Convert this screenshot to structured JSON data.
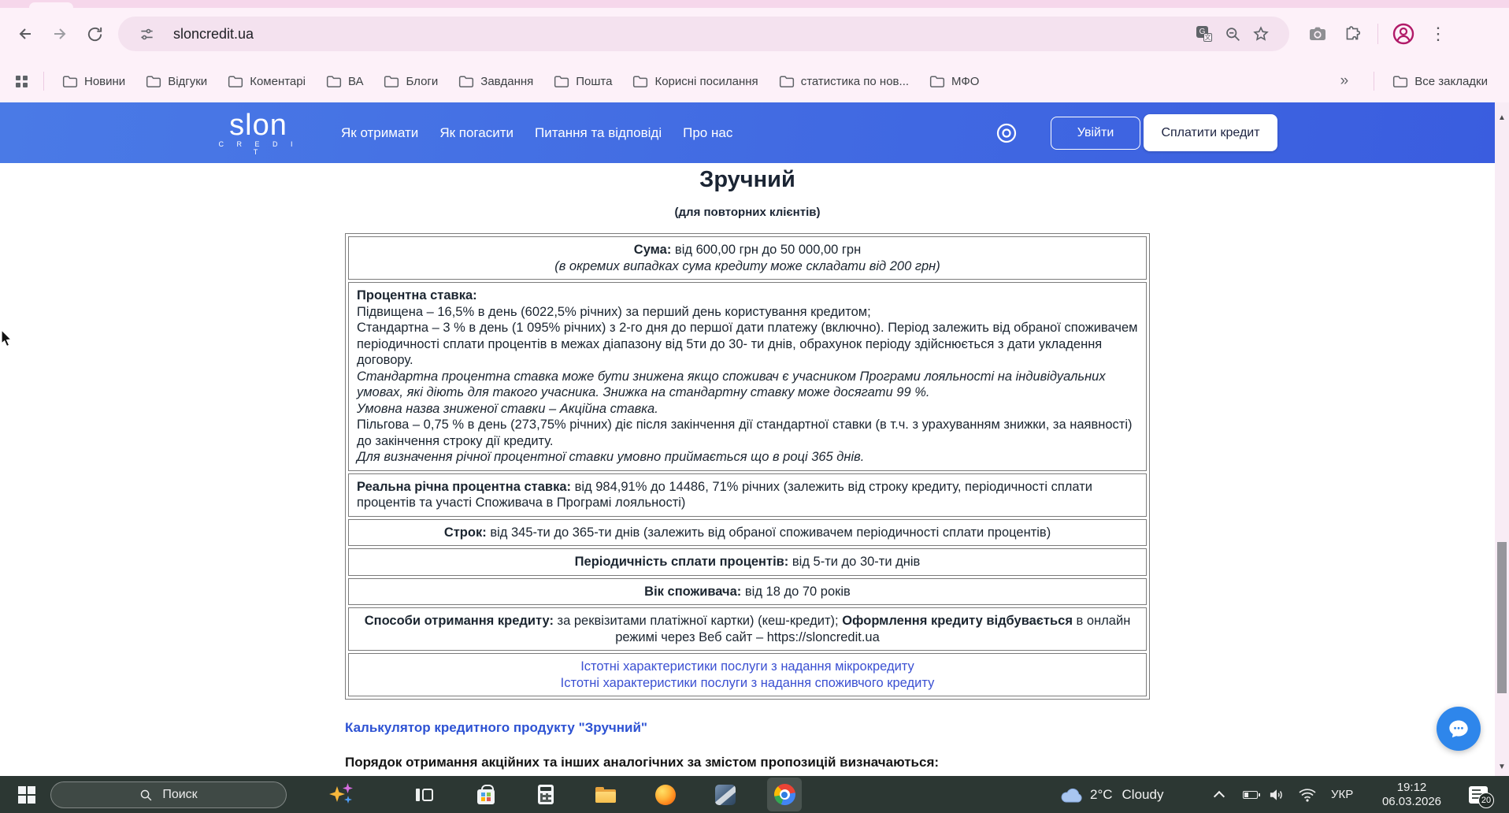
{
  "browser": {
    "url": "sloncredit.ua",
    "bookmarks": [
      "Новини",
      "Відгуки",
      "Коментарі",
      "ВА",
      "Блоги",
      "Завдання",
      "Пошта",
      "Корисні посилання",
      "статистика по нов...",
      "МФО"
    ],
    "overflow_chevron": "»",
    "all_bookmarks_label": "Все закладки",
    "menu_glyph": "⋮"
  },
  "site": {
    "logo_text": "slon",
    "logo_sub": "C R E D I T",
    "nav": [
      "Як отримати",
      "Як погасити",
      "Питання та відповіді",
      "Про нас"
    ],
    "login_button": "Увійти",
    "pay_button": "Сплатити кредит"
  },
  "page": {
    "title": "Зручний",
    "subtitle": "(для повторних клієнтів)",
    "table": {
      "sum_label": "Сума:",
      "sum_value": " від 600,00 грн до 50 000,00 грн",
      "sum_note": "(в окремих випадках сума кредиту може складати від 200 грн)",
      "rate_heading": "Процентна ставка:",
      "rate_line1": "Підвищена  – 16,5% в день  (6022,5% річних) за перший день користування кредитом;",
      "rate_line2": "Стандартна – 3 % в день (1 095% річних)  з 2-го дня до першої дати платежу (включно). Період залежить  від обраної споживачем періодичності сплати процентів в межах діапазону від 5ти до 30- ти днів, обрахунок періоду здійснюється   з дати укладення договору.",
      "rate_line3": "Стандартна процентна ставка може бути знижена якщо споживач є учасником Програми лояльності на індивідуальних  умовах, які діють для такого учасника. Знижка на стандартну ставку може досягати 99 %.",
      "rate_line4": "Умовна назва зниженої ставки – Акційна ставка.",
      "rate_line5": "Пільгова – 0,75 % в день (273,75% річних)  діє після закінчення дії стандартної ставки (в т.ч. з урахуванням знижки, за наявності)  до закінчення строку дії кредиту.",
      "rate_line6": "Для визначення річної процентної ставки умовно приймається що в році 365 днів.",
      "apr_label": "Реальна річна процентна ставка:",
      "apr_value": " від 984,91% до 14486, 71% річних (залежить від строку кредиту, періодичності сплати процентів та участі Споживача в Програмі лояльності)",
      "term_label": "Строк:",
      "term_value": " від 345-ти до 365-ти днів (залежить від обраної споживачем періодичності сплати процентів)",
      "periodicity_label": "Періодичність сплати процентів:",
      "periodicity_value": " від 5-ти до 30-ти днів",
      "age_label": "Вік споживача:",
      "age_value": " від 18 до 70 років",
      "methods_label": "Способи отримання кредиту:",
      "methods_value1": " за реквізитами платіжної картки) (кеш-кредит); ",
      "methods_bold2": "Оформлення кредиту відбувається",
      "methods_value2": " в онлайн режимі через Веб сайт – https://sloncredit.ua",
      "link1": "Істотні характеристики послуги з надання мікрокредиту",
      "link2": "Істотні характеристики послуги з надання споживчого кредиту"
    },
    "calculator_link": "Калькулятор кредитного продукту \"Зручний\"",
    "order_heading": "Порядок отримання акційних та інших аналогічних за змістом пропозицій визначаються:"
  },
  "taskbar": {
    "search_label": "Поиск",
    "weather_temp": "2°C",
    "weather_condition": "Cloudy",
    "language": "УКР",
    "time": "19:12",
    "date": "06.03.2026",
    "notification_count": "20"
  },
  "colors": {
    "header_blue": "#3d66e0",
    "link_blue": "#3b50d2",
    "chrome_pink": "#fdf1f9",
    "taskbar_dark": "#2c3733",
    "chat_accent": "#2e86eb"
  }
}
